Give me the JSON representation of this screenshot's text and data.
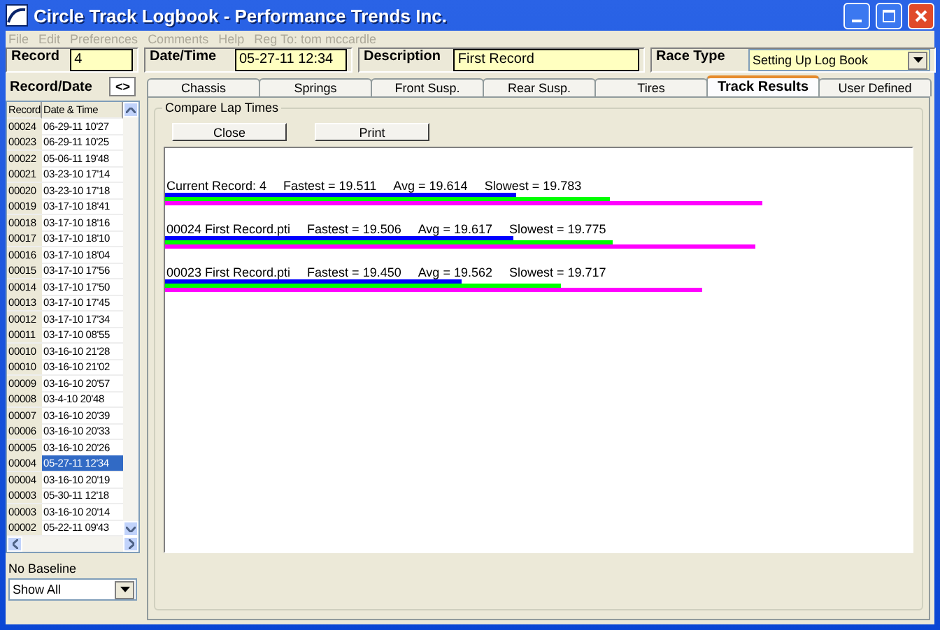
{
  "window": {
    "title": "Circle Track Logbook - Performance Trends Inc."
  },
  "menu": [
    {
      "label": "File"
    },
    {
      "label": "Edit"
    },
    {
      "label": "Preferences"
    },
    {
      "label": "Comments"
    },
    {
      "label": "Help"
    },
    {
      "label": "Reg To: tom mccardle"
    }
  ],
  "header": {
    "record_label": "Record",
    "record": "4",
    "datetime_label": "Date/Time",
    "datetime": "05-27-11 12:34",
    "description_label": "Description",
    "description": "First Record",
    "race_type_label": "Race Type",
    "race_type": "Setting Up Log Book"
  },
  "sidebar": {
    "title": "Record/Date",
    "toggle": "<>",
    "columns": [
      "Record",
      "Date & Time"
    ],
    "rows": [
      {
        "record": "00024",
        "date": "06-29-11 10'27",
        "selected": false
      },
      {
        "record": "00023",
        "date": "06-29-11 10'25",
        "selected": false
      },
      {
        "record": "00022",
        "date": "05-06-11 19'48",
        "selected": false
      },
      {
        "record": "00021",
        "date": "03-23-10 17'14",
        "selected": false
      },
      {
        "record": "00020",
        "date": "03-23-10 17'18",
        "selected": false
      },
      {
        "record": "00019",
        "date": "03-17-10 18'41",
        "selected": false
      },
      {
        "record": "00018",
        "date": "03-17-10 18'16",
        "selected": false
      },
      {
        "record": "00017",
        "date": "03-17-10 18'10",
        "selected": false
      },
      {
        "record": "00016",
        "date": "03-17-10 18'04",
        "selected": false
      },
      {
        "record": "00015",
        "date": "03-17-10 17'56",
        "selected": false
      },
      {
        "record": "00014",
        "date": "03-17-10 17'50",
        "selected": false
      },
      {
        "record": "00013",
        "date": "03-17-10 17'45",
        "selected": false
      },
      {
        "record": "00012",
        "date": "03-17-10 17'34",
        "selected": false
      },
      {
        "record": "00011",
        "date": "03-17-10 08'55",
        "selected": false
      },
      {
        "record": "00010",
        "date": "03-16-10 21'28",
        "selected": false
      },
      {
        "record": "00010",
        "date": "03-16-10 21'02",
        "selected": false
      },
      {
        "record": "00009",
        "date": "03-16-10 20'57",
        "selected": false
      },
      {
        "record": "00008",
        "date": "03-4-10 20'48",
        "selected": false
      },
      {
        "record": "00007",
        "date": "03-16-10 20'39",
        "selected": false
      },
      {
        "record": "00006",
        "date": "03-16-10 20'33",
        "selected": false
      },
      {
        "record": "00005",
        "date": "03-16-10 20'26",
        "selected": false
      },
      {
        "record": "00004",
        "date": "05-27-11 12'34",
        "selected": true
      },
      {
        "record": "00004",
        "date": "03-16-10 20'19",
        "selected": false
      },
      {
        "record": "00003",
        "date": "05-30-11 12'18",
        "selected": false
      },
      {
        "record": "00003",
        "date": "03-16-10 20'14",
        "selected": false
      },
      {
        "record": "00002",
        "date": "05-22-11 09'43",
        "selected": false
      }
    ],
    "baseline": "No Baseline",
    "filter": "Show All"
  },
  "tabs": [
    {
      "label": "Chassis",
      "selected": false
    },
    {
      "label": "Springs",
      "selected": false
    },
    {
      "label": "Front Susp.",
      "selected": false
    },
    {
      "label": "Rear Susp.",
      "selected": false
    },
    {
      "label": "Tires",
      "selected": false
    },
    {
      "label": "Track Results",
      "selected": true
    },
    {
      "label": "User Defined",
      "selected": false
    }
  ],
  "compare": {
    "title": "Compare Lap Times",
    "buttons": [
      "Close",
      "Print"
    ],
    "results": [
      {
        "label": "Current Record: 4",
        "fastest": "Fastest = 19.511",
        "avg": "Avg = 19.614",
        "slowest": "Slowest = 19.783",
        "bars": [
          {
            "color": "#0000ff",
            "level": 0.47
          },
          {
            "color": "#00ff00",
            "level": 0.595
          },
          {
            "color": "#ff00ff",
            "level": 0.8
          }
        ]
      },
      {
        "label": "00024  First Record.pti",
        "fastest": "Fastest = 19.506",
        "avg": "Avg = 19.617",
        "slowest": "Slowest = 19.775",
        "bars": [
          {
            "color": "#0000ff",
            "level": 0.466
          },
          {
            "color": "#00ff00",
            "level": 0.6
          },
          {
            "color": "#ff00ff",
            "level": 0.79
          }
        ]
      },
      {
        "label": "00023  First Record.pti",
        "fastest": "Fastest = 19.450",
        "avg": "Avg = 19.562",
        "slowest": "Slowest = 19.717",
        "bars": [
          {
            "color": "#0000ff",
            "level": 0.397
          },
          {
            "color": "#00ff00",
            "level": 0.53
          },
          {
            "color": "#ff00ff",
            "level": 0.72
          }
        ]
      }
    ]
  }
}
